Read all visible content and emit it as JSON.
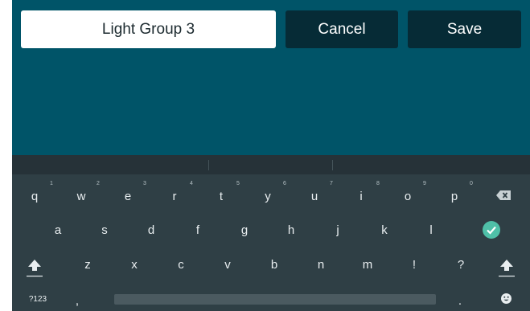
{
  "form": {
    "group_name_value": "Light Group 3",
    "cancel_label": "Cancel",
    "save_label": "Save"
  },
  "keyboard": {
    "row1": [
      {
        "key": "q",
        "hint": "1"
      },
      {
        "key": "w",
        "hint": "2"
      },
      {
        "key": "e",
        "hint": "3"
      },
      {
        "key": "r",
        "hint": "4"
      },
      {
        "key": "t",
        "hint": "5"
      },
      {
        "key": "y",
        "hint": "6"
      },
      {
        "key": "u",
        "hint": "7"
      },
      {
        "key": "i",
        "hint": "8"
      },
      {
        "key": "o",
        "hint": "9"
      },
      {
        "key": "p",
        "hint": "0"
      }
    ],
    "row2": [
      "a",
      "s",
      "d",
      "f",
      "g",
      "h",
      "j",
      "k",
      "l"
    ],
    "row3": [
      "z",
      "x",
      "c",
      "v",
      "b",
      "n",
      "m",
      "!",
      "?"
    ],
    "symbols_label": "?123",
    "comma": ",",
    "period": "."
  },
  "colors": {
    "background": "#005468",
    "button": "#062b36",
    "keyboard": "#2f3f45",
    "done_key": "#4fc0a8"
  },
  "icons": [
    "backspace-icon",
    "done-check-icon",
    "shift-left-icon",
    "shift-right-icon",
    "emoji-icon"
  ]
}
